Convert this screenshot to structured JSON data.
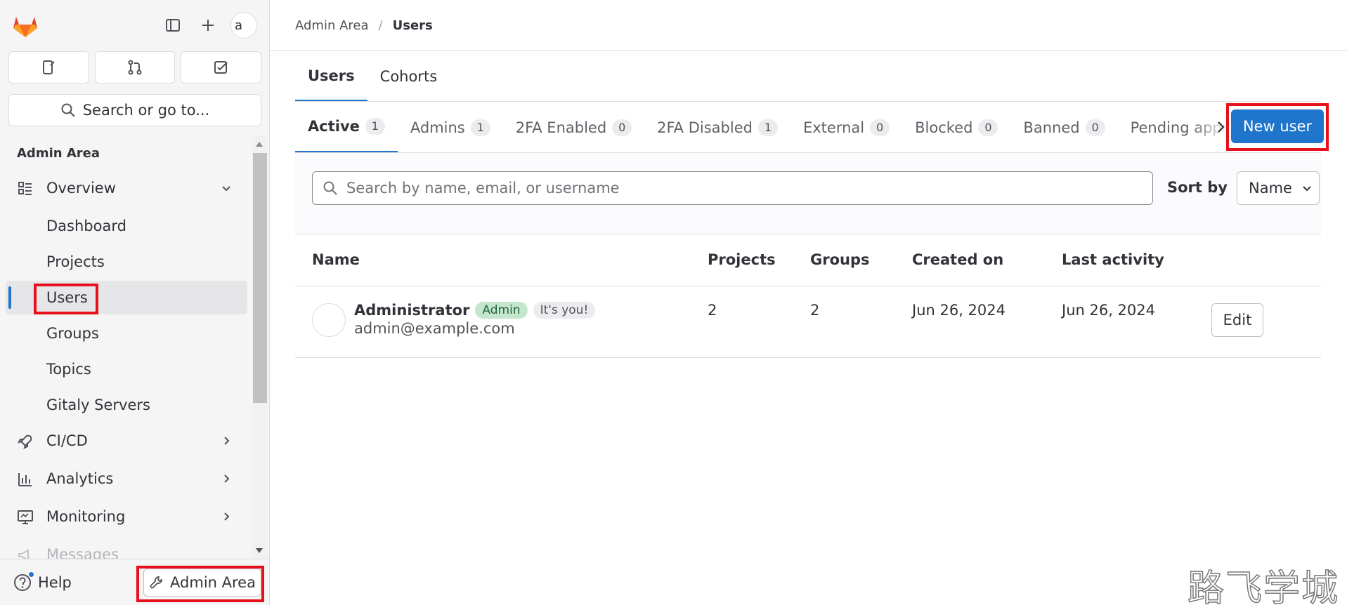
{
  "sidebar": {
    "search_placeholder": "Search or go to...",
    "avatar_text": "a",
    "section_heading": "Admin Area",
    "nav": {
      "overview": "Overview",
      "dashboard": "Dashboard",
      "projects": "Projects",
      "users": "Users",
      "groups": "Groups",
      "topics": "Topics",
      "gitaly": "Gitaly Servers",
      "cicd": "CI/CD",
      "analytics": "Analytics",
      "monitoring": "Monitoring",
      "messages": "Messages"
    },
    "help_label": "Help",
    "admin_area_label": "Admin Area"
  },
  "breadcrumb": {
    "root": "Admin Area",
    "separator": "/",
    "current": "Users"
  },
  "page_tabs": [
    "Users",
    "Cohorts"
  ],
  "user_tabs": [
    {
      "label": "Active",
      "count": "1"
    },
    {
      "label": "Admins",
      "count": "1"
    },
    {
      "label": "2FA Enabled",
      "count": "0"
    },
    {
      "label": "2FA Disabled",
      "count": "1"
    },
    {
      "label": "External",
      "count": "0"
    },
    {
      "label": "Blocked",
      "count": "0"
    },
    {
      "label": "Banned",
      "count": "0"
    },
    {
      "label": "Pending approval",
      "count": ""
    }
  ],
  "new_user_label": "New user",
  "filter": {
    "search_placeholder": "Search by name, email, or username",
    "sort_label": "Sort by",
    "sort_value": "Name"
  },
  "table": {
    "headers": [
      "Name",
      "Projects",
      "Groups",
      "Created on",
      "Last activity"
    ],
    "rows": [
      {
        "name": "Administrator",
        "badge_admin": "Admin",
        "badge_you": "It's you!",
        "email": "admin@example.com",
        "projects": "2",
        "groups": "2",
        "created_on": "Jun 26, 2024",
        "last_activity": "Jun 26, 2024",
        "action": "Edit"
      }
    ]
  },
  "watermark": "路飞学城",
  "colors": {
    "accent": "#1f75cb",
    "highlight": "#e8101a",
    "admin_badge": "#c3e6cd"
  }
}
